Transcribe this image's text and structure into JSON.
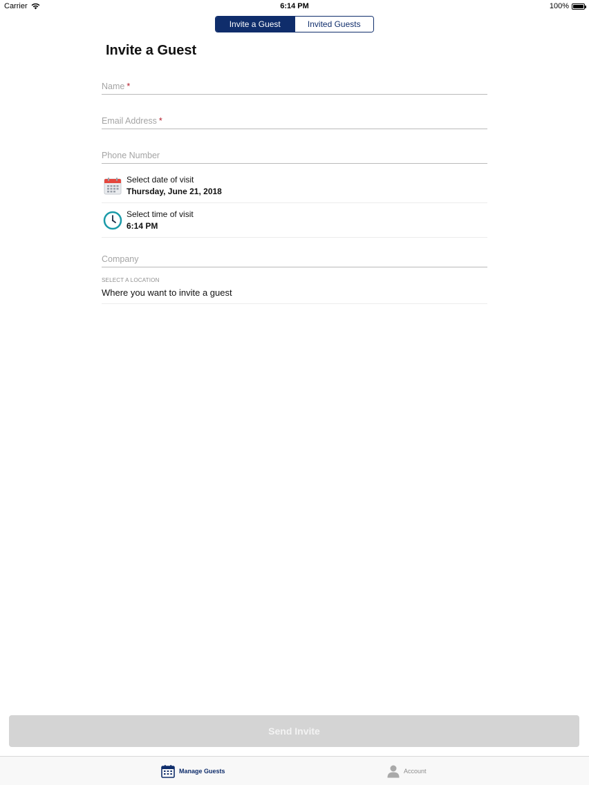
{
  "status_bar": {
    "carrier": "Carrier",
    "time": "6:14 PM",
    "battery": "100%"
  },
  "tabs_top": [
    {
      "label": "Invite a Guest",
      "active": true
    },
    {
      "label": "Invited Guests",
      "active": false
    }
  ],
  "page": {
    "title": "Invite a Guest"
  },
  "form": {
    "name_placeholder": "Name",
    "email_placeholder": "Email Address",
    "phone_placeholder": "Phone Number",
    "required_marker": "*",
    "date": {
      "caption": "Select date of visit",
      "value": "Thursday, June 21, 2018",
      "icon": "calendar-icon"
    },
    "time": {
      "caption": "Select time of visit",
      "value": "6:14 PM",
      "icon": "clock-icon"
    },
    "company_placeholder": "Company",
    "location": {
      "caption": "SELECT A LOCATION",
      "value": "Where you want to invite a guest"
    }
  },
  "actions": {
    "send_label": "Send Invite"
  },
  "tab_bar": {
    "items": [
      {
        "label": "Manage Guests",
        "icon": "calendar-icon",
        "active": true
      },
      {
        "label": "Account",
        "icon": "person-icon",
        "active": false
      }
    ]
  },
  "colors": {
    "primary": "#0f2d6b",
    "required": "#b31b2a",
    "disabled_button": "#d4d4d4",
    "clock_teal": "#1a9aa8",
    "calendar_red": "#e5473e"
  }
}
